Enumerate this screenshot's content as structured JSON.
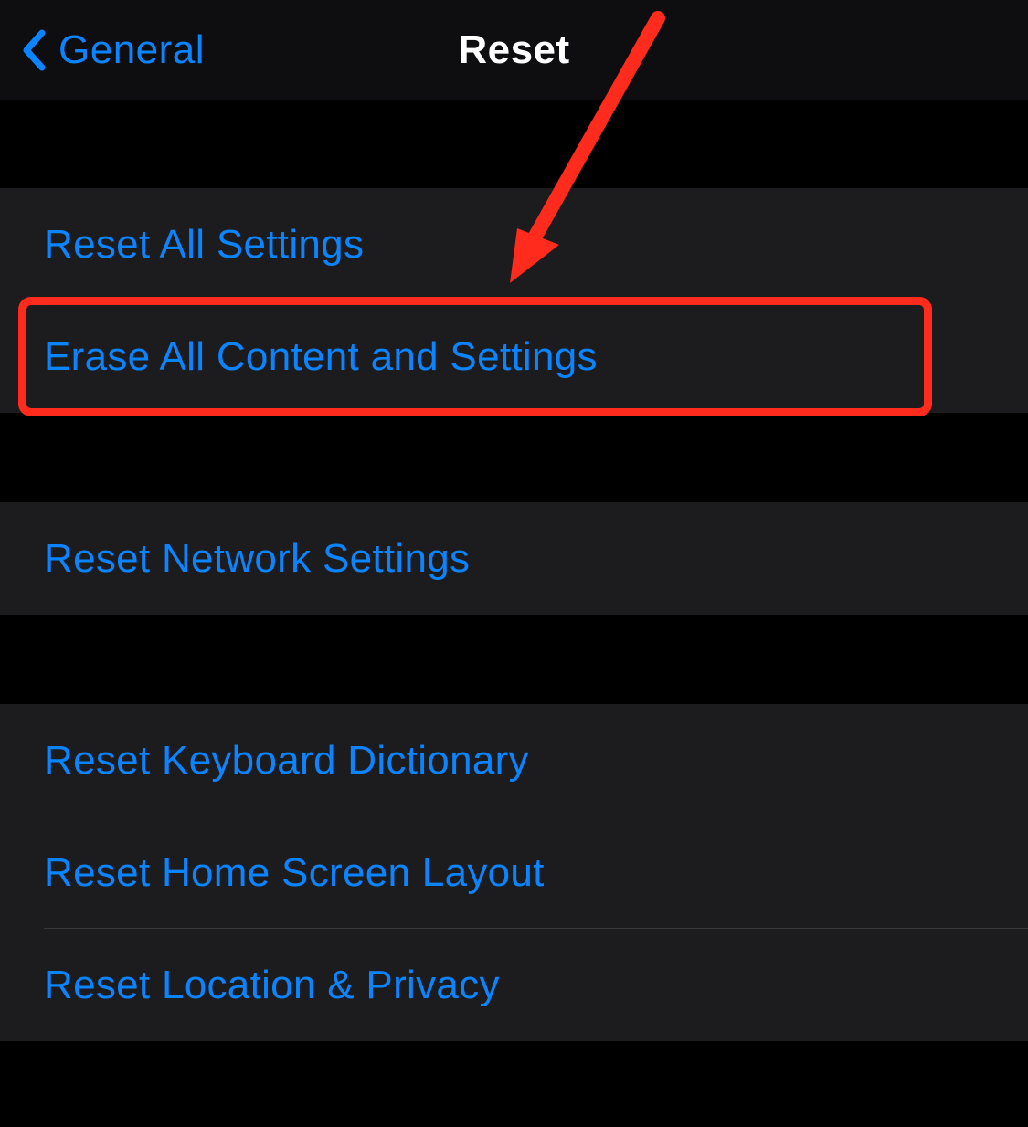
{
  "nav": {
    "back_label": "General",
    "title": "Reset"
  },
  "groups": [
    {
      "items": [
        {
          "id": "reset-all-settings",
          "label": "Reset All Settings"
        },
        {
          "id": "erase-all-content",
          "label": "Erase All Content and Settings"
        }
      ]
    },
    {
      "items": [
        {
          "id": "reset-network",
          "label": "Reset Network Settings"
        }
      ]
    },
    {
      "items": [
        {
          "id": "reset-keyboard",
          "label": "Reset Keyboard Dictionary"
        },
        {
          "id": "reset-home-screen",
          "label": "Reset Home Screen Layout"
        },
        {
          "id": "reset-location-privacy",
          "label": "Reset Location & Privacy"
        }
      ]
    }
  ],
  "colors": {
    "accent": "#0b84ff",
    "annotation": "#ff2b1c",
    "list_bg": "#1c1c1e",
    "page_bg": "#000000"
  }
}
